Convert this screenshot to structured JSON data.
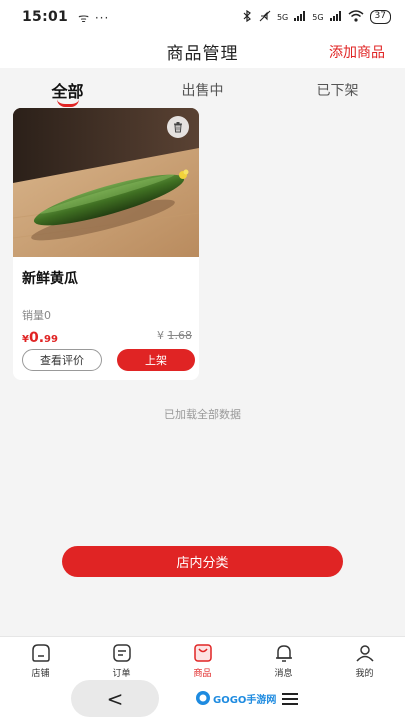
{
  "status_bar": {
    "time": "15:01",
    "extra": "ᯤ ···",
    "signal_a": "5G",
    "signal_b": "5G",
    "battery": "37"
  },
  "header": {
    "title": "商品管理",
    "action_label": "添加商品"
  },
  "tabs": [
    {
      "label": "全部",
      "active": true
    },
    {
      "label": "出售中",
      "active": false
    },
    {
      "label": "已下架",
      "active": false
    }
  ],
  "product": {
    "name": "新鲜黄瓜",
    "sales": "销量0",
    "price_symbol": "¥",
    "price_int": "0.",
    "price_dec": "99",
    "original_symbol": "¥",
    "original_price": "1.68",
    "review_label": "查看评价",
    "shelve_label": "上架",
    "image_icon": "trash-icon"
  },
  "list_footer": "已加载全部数据",
  "category_button": "店内分类",
  "bottom_nav": [
    {
      "label": "店铺",
      "icon": "store-icon",
      "active": false
    },
    {
      "label": "订单",
      "icon": "order-icon",
      "active": false
    },
    {
      "label": "商品",
      "icon": "product-icon",
      "active": true
    },
    {
      "label": "消息",
      "icon": "bell-icon",
      "active": false
    },
    {
      "label": "我的",
      "icon": "user-icon",
      "active": false
    }
  ],
  "system_nav": {
    "back": "<",
    "watermark": "GOGO手游网"
  },
  "colors": {
    "accent": "#e02424",
    "background": "#f4f4f4"
  }
}
